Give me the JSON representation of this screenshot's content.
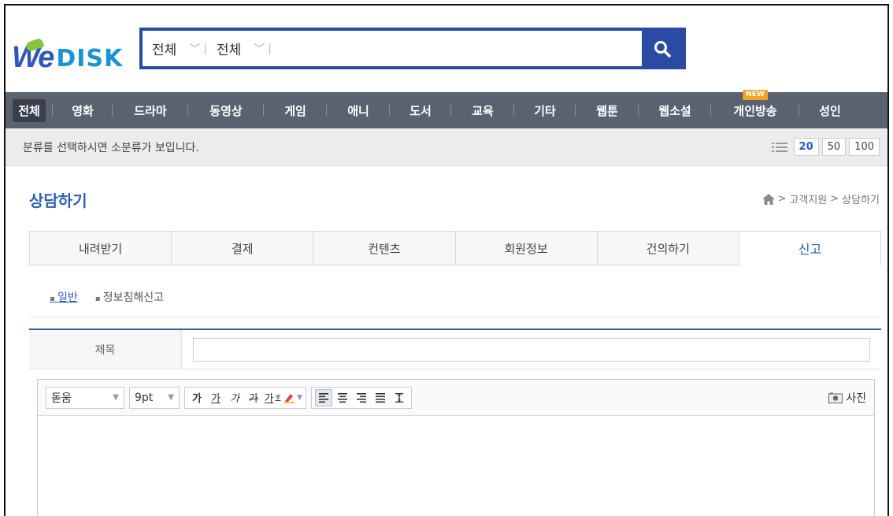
{
  "header": {
    "logo_we": "We",
    "logo_disk": "DISK",
    "search": {
      "category1": "전체",
      "category2": "전체",
      "placeholder": ""
    }
  },
  "categories": [
    {
      "label": "전체",
      "active": true
    },
    {
      "label": "영화"
    },
    {
      "label": "드라마"
    },
    {
      "label": "동영상"
    },
    {
      "label": "게임"
    },
    {
      "label": "애니"
    },
    {
      "label": "도서"
    },
    {
      "label": "교육"
    },
    {
      "label": "기타"
    },
    {
      "label": "웹툰"
    },
    {
      "label": "웹소설"
    },
    {
      "label": "개인방송",
      "badge": "NEW"
    },
    {
      "label": "성인"
    }
  ],
  "subbar": {
    "message": "분류를 선택하시면 소분류가 보입니다.",
    "per_page": [
      "20",
      "50",
      "100"
    ],
    "per_page_selected": "20"
  },
  "page": {
    "title": "상담하기",
    "breadcrumb": [
      "고객지원",
      "상담하기"
    ]
  },
  "tabs": [
    "내려받기",
    "결제",
    "컨텐츠",
    "회원정보",
    "건의하기",
    "신고"
  ],
  "active_tab": 5,
  "subtabs": [
    "일반",
    "정보침해신고"
  ],
  "form": {
    "title_label": "제목",
    "title_value": ""
  },
  "editor": {
    "font": "돋움",
    "size": "9pt",
    "btn_bold": "가",
    "btn_underline": "가",
    "btn_italic": "가",
    "btn_strike": "가",
    "btn_color": "가",
    "photo_label": "사진"
  },
  "colors": {
    "accent": "#2b4aa3",
    "nav_bg": "#5a6270",
    "title_blue": "#2e5fb3",
    "badge": "#f3a32b"
  }
}
